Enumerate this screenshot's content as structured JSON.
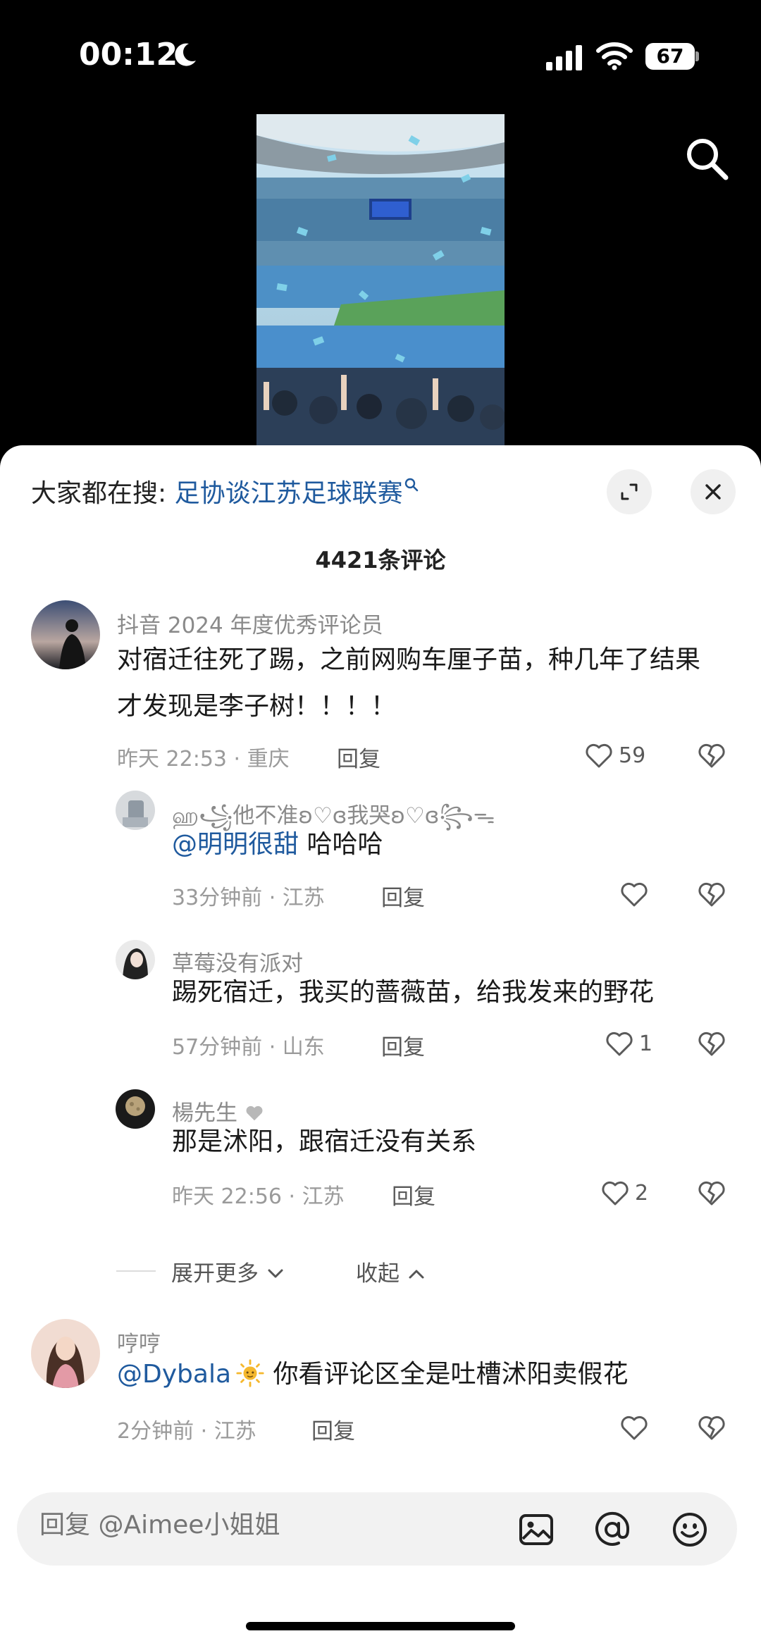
{
  "status": {
    "time": "00:12",
    "battery": "67"
  },
  "video": {
    "thumbnail": "stadium-confetti-video"
  },
  "panel": {
    "hint_prefix": "大家都在搜: ",
    "hint_term": "足协谈江苏足球联赛",
    "comment_count": "4421条评论"
  },
  "comments": [
    {
      "name": "抖音 2024 年度优秀评论员",
      "text": "对宿迁往死了踢，之前网购车厘子苗，种几年了结果才发现是李子树！！！！",
      "meta": "昨天 22:53 · 重庆",
      "reply": "回复",
      "likes": "59"
    },
    {
      "name": "ஹ꧁他不准ʚ♡ɞ我哭ʚ♡ɞ꧂ᯓ",
      "mention": "@明明很甜",
      "text": " 哈哈哈",
      "meta": "33分钟前 · 江苏",
      "reply": "回复",
      "likes": ""
    },
    {
      "name": "草莓没有派对",
      "text": "踢死宿迁，我买的蔷薇苗，给我发来的野花",
      "meta": "57分钟前 · 山东",
      "reply": "回复",
      "likes": "1"
    },
    {
      "name": "楊先生",
      "text": "那是沭阳，跟宿迁没有关系",
      "meta": "昨天 22:56 · 江苏",
      "reply": "回复",
      "likes": "2"
    },
    {
      "name": "哼哼",
      "mention": "@Dybala",
      "text": " 你看评论区全是吐槽沭阳卖假花",
      "meta": "2分钟前 · 江苏",
      "reply": "回复",
      "likes": ""
    }
  ],
  "expand": {
    "more": "展开更多",
    "collapse": "收起"
  },
  "input": {
    "placeholder": "回复 @Aimee小姐姐"
  },
  "colors": {
    "link": "#1f5a9e",
    "meta": "#9a9a9a",
    "background": "#ffffff"
  }
}
